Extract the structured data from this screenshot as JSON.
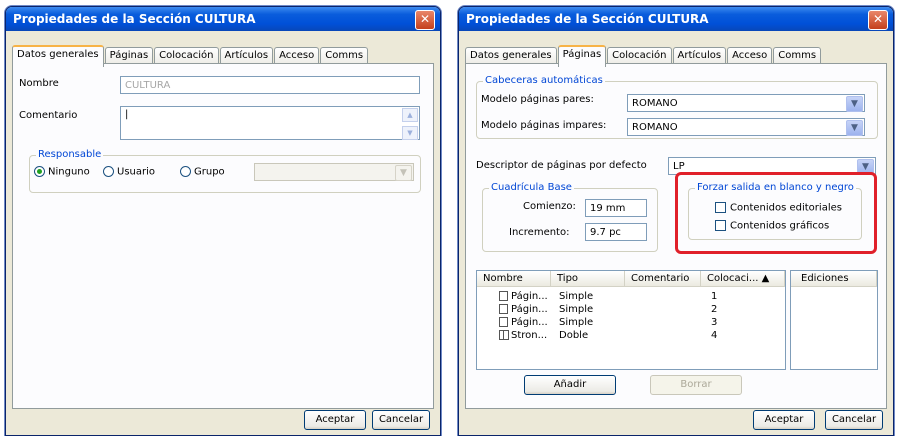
{
  "left": {
    "title": "Propiedades de la Sección  CULTURA",
    "close": "✕",
    "tabs": [
      "Datos generales",
      "Páginas",
      "Colocación",
      "Artículos",
      "Acceso",
      "Comms"
    ],
    "name_label": "Nombre",
    "name_value": "CULTURA",
    "comment_label": "Comentario",
    "comment_value": "|",
    "responsable_title": "Responsable",
    "radio_ninguno": "Ninguno",
    "radio_usuario": "Usuario",
    "radio_grupo": "Grupo",
    "accept": "Aceptar",
    "cancel": "Cancelar"
  },
  "right": {
    "title": "Propiedades de la Sección  CULTURA",
    "close": "✕",
    "tabs": [
      "Datos generales",
      "Páginas",
      "Colocación",
      "Artículos",
      "Acceso",
      "Comms"
    ],
    "auto_headers_title": "Cabeceras automáticas",
    "even_label": "Modelo páginas pares:",
    "even_value": "ROMANO",
    "odd_label": "Modelo páginas impares:",
    "odd_value": "ROMANO",
    "descriptor_label": "Descriptor de páginas por defecto",
    "descriptor_value": "LP",
    "grid_title": "Cuadrícula Base",
    "start_label": "Comienzo:",
    "start_value": "19 mm",
    "increment_label": "Incremento:",
    "increment_value": "9.7 pc",
    "bw_title": "Forzar salida en blanco y negro",
    "bw_editorial": "Contenidos editoriales",
    "bw_graphic": "Contenidos gráficos",
    "highlight_color": "#e0202a",
    "list_headers": [
      "Nombre",
      "Tipo",
      "Comentario",
      "Colocaci... ▲"
    ],
    "editions_header": "Ediciones",
    "rows": [
      {
        "name": "Págin...",
        "type": "Simple",
        "pos": "1"
      },
      {
        "name": "Págin...",
        "type": "Simple",
        "pos": "2"
      },
      {
        "name": "Págin...",
        "type": "Simple",
        "pos": "3"
      },
      {
        "name": "Stron...",
        "type": "Doble",
        "pos": "4"
      }
    ],
    "add_button": "Añadir",
    "delete_button": "Borrar",
    "accept": "Aceptar",
    "cancel": "Cancelar"
  }
}
